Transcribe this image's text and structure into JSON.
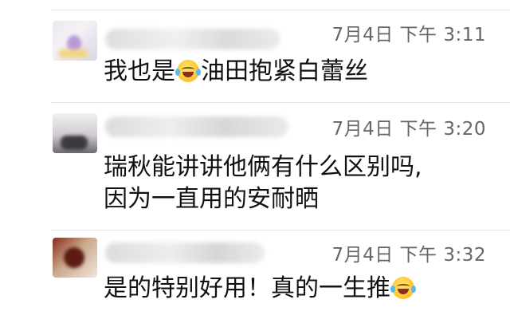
{
  "comments": [
    {
      "time": "7月4日 下午 3:11",
      "text_before": "我也是",
      "emoji": "laughing-tears-emoji",
      "text_after": "油田抱紧白蕾丝",
      "name_blurred": "…"
    },
    {
      "time": "7月4日 下午 3:20",
      "line1": "瑞秋能讲讲他俩有什么区别吗,",
      "line2": "因为一直用的安耐晒"
    },
    {
      "time": "7月4日 下午 3:32",
      "text_before": "是的特别好用！真的一生推",
      "emoji": "laughing-tears-emoji"
    }
  ]
}
